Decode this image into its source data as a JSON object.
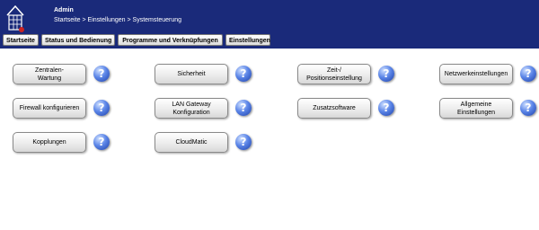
{
  "header": {
    "user": "Admin",
    "breadcrumb": "Startseite > Einstellungen > Systemsteuerung",
    "background": "#1a2a7a"
  },
  "menu": {
    "items": [
      {
        "label": "Startseite"
      },
      {
        "label": "Status und Bedienung"
      },
      {
        "label": "Programme und Verknüpfungen"
      },
      {
        "label": "Einstellungen"
      }
    ]
  },
  "tiles": [
    {
      "label": "Zentralen-\nWartung",
      "help_icon": "question-mark-icon"
    },
    {
      "label": "Sicherheit",
      "help_icon": "question-mark-icon"
    },
    {
      "label": "Zeit-/\nPositionseinstellung",
      "help_icon": "question-mark-icon"
    },
    {
      "label": "Netzwerkeinstellungen",
      "help_icon": "question-mark-icon"
    },
    {
      "label": "Firewall konfigurieren",
      "help_icon": "question-mark-icon"
    },
    {
      "label": "LAN Gateway\nKonfiguration",
      "help_icon": "question-mark-icon"
    },
    {
      "label": "Zusatzsoftware",
      "help_icon": "question-mark-icon"
    },
    {
      "label": "Allgemeine\nEinstellungen",
      "help_icon": "question-mark-icon"
    },
    {
      "label": "Kopplungen",
      "help_icon": "question-mark-icon"
    },
    {
      "label": "CloudMatic",
      "help_icon": "question-mark-icon"
    }
  ],
  "help_glyph": "?"
}
